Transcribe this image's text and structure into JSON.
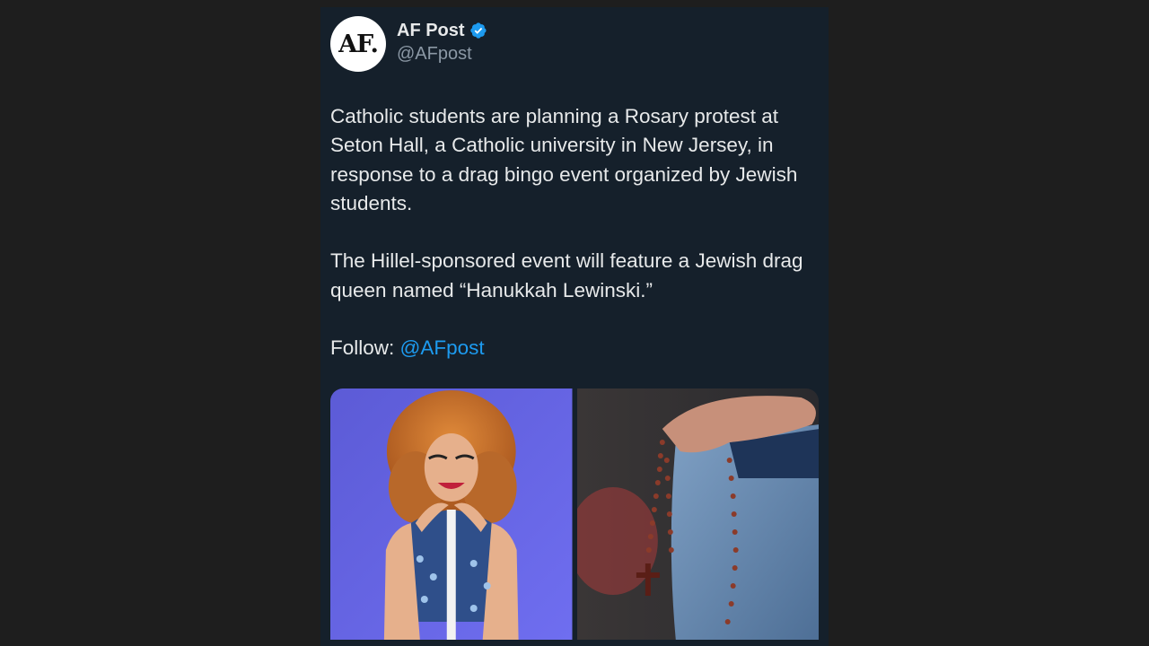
{
  "tweet": {
    "avatar_text": "AF.",
    "display_name": "AF Post",
    "handle": "@AFpost",
    "verified_icon": "verified-badge-icon",
    "paragraph_1": "Catholic students are planning a Rosary protest at Seton Hall, a Catholic university in New Jersey, in response to a drag bingo event organized by Jewish students.",
    "paragraph_2": "The Hillel-sponsored event will feature a Jewish drag queen named “Hanukkah Lewinski.”",
    "follow_label": "Follow: ",
    "follow_link": "@AFpost"
  },
  "colors": {
    "background": "#1e1e1e",
    "card": "#15202b",
    "text": "#e7e9ea",
    "muted": "#8b98a5",
    "accent": "#1d9bf0"
  }
}
